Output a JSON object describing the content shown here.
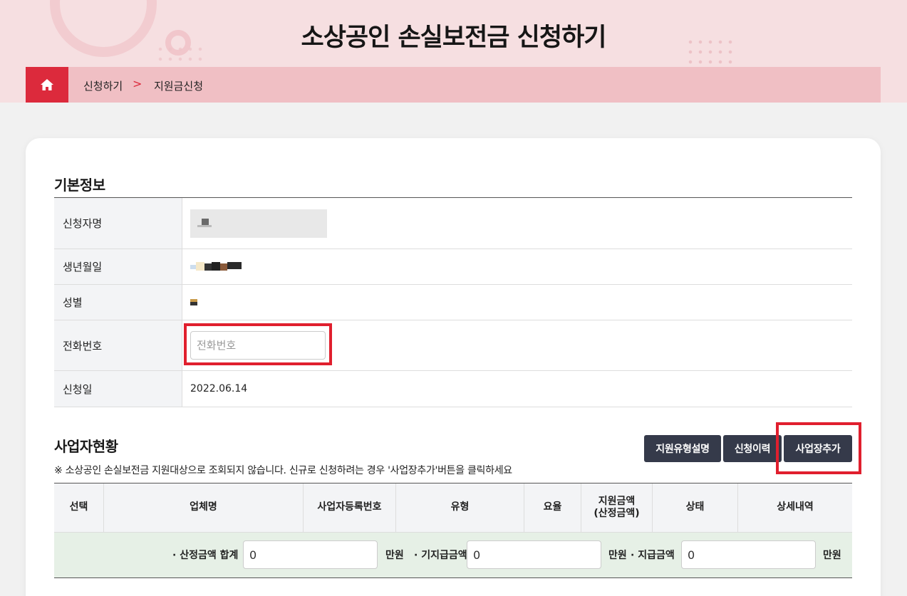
{
  "header": {
    "title": "소상공인 손실보전금 신청하기",
    "breadcrumb": [
      "신청하기",
      "지원금신청"
    ],
    "breadcrumb_separator": ">"
  },
  "basic_info": {
    "title": "기본정보",
    "rows": {
      "name_label": "신청자명",
      "birth_label": "생년월일",
      "gender_label": "성별",
      "phone_label": "전화번호",
      "phone_placeholder": "전화번호",
      "phone_value": "",
      "date_label": "신청일",
      "date_value": "2022.06.14"
    }
  },
  "business": {
    "title": "사업자현황",
    "notice": "※ 소상공인 손실보전금 지원대상으로 조회되지 않습니다. 신규로 신청하려는 경우 '사업장추가'버튼을 클릭하세요",
    "buttons": {
      "guide": "지원유형설명",
      "history": "신청이력",
      "add": "사업장추가"
    },
    "columns": [
      "선택",
      "업체명",
      "사업자등록번호",
      "유형",
      "요율",
      "지원금액\n(산정금액)",
      "상태",
      "상세내역"
    ],
    "summary": {
      "calc_label": "· 산정금액 합계",
      "calc_value": "0",
      "unit1": "만원",
      "paid_label": "· 기지급금액",
      "paid_value": "0",
      "unit2": "만원",
      "pay_label": "· 지급금액",
      "pay_value": "0",
      "unit3": "만원"
    }
  },
  "colors": {
    "accent": "#dc2a3c",
    "highlight_box": "#e01f2e",
    "button": "#353a4a",
    "summary_bg": "#e6f0e6"
  }
}
